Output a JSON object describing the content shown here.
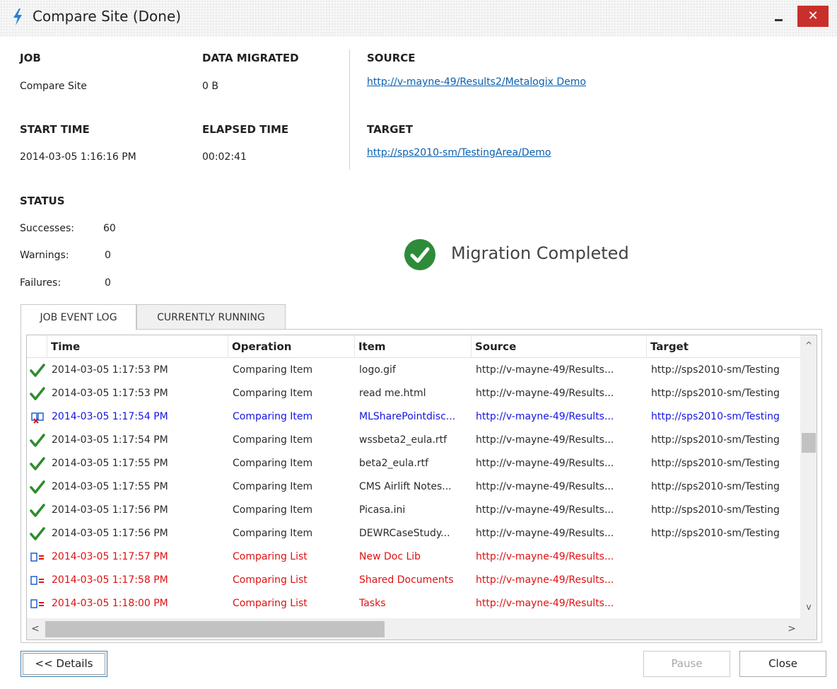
{
  "window": {
    "title": "Compare Site (Done)",
    "close_glyph": "✕"
  },
  "summary": {
    "job_label": "JOB",
    "job_value": "Compare Site",
    "data_migrated_label": "DATA MIGRATED",
    "data_migrated_value": "0 B",
    "start_time_label": "START TIME",
    "start_time_value": "2014-03-05 1:16:16 PM",
    "elapsed_time_label": "ELAPSED TIME",
    "elapsed_time_value": "00:02:41",
    "source_label": "SOURCE",
    "source_url": "http://v-mayne-49/Results2/Metalogix Demo",
    "target_label": "TARGET",
    "target_url": "http://sps2010-sm/TestingArea/Demo"
  },
  "status": {
    "label": "STATUS",
    "successes_label": "Successes:",
    "successes_value": "60",
    "warnings_label": "Warnings:",
    "warnings_value": "0",
    "failures_label": "Failures:",
    "failures_value": "0",
    "message": "Migration Completed"
  },
  "tabs": [
    {
      "label": "JOB EVENT LOG",
      "active": true
    },
    {
      "label": "CURRENTLY RUNNING",
      "active": false
    }
  ],
  "log": {
    "columns": [
      "Time",
      "Operation",
      "Item",
      "Source",
      "Target"
    ],
    "rows": [
      {
        "status": "success",
        "time": "2014-03-05 1:17:53 PM",
        "operation": "Comparing Item",
        "item": "logo.gif",
        "source": "http://v-mayne-49/Results...",
        "target": "http://sps2010-sm/Testing"
      },
      {
        "status": "success",
        "time": "2014-03-05 1:17:53 PM",
        "operation": "Comparing Item",
        "item": "read me.html",
        "source": "http://v-mayne-49/Results...",
        "target": "http://sps2010-sm/Testing"
      },
      {
        "status": "difference",
        "time": "2014-03-05 1:17:54 PM",
        "operation": "Comparing Item",
        "item": "MLSharePointdisc...",
        "source": "http://v-mayne-49/Results...",
        "target": "http://sps2010-sm/Testing"
      },
      {
        "status": "success",
        "time": "2014-03-05 1:17:54 PM",
        "operation": "Comparing Item",
        "item": "wssbeta2_eula.rtf",
        "source": "http://v-mayne-49/Results...",
        "target": "http://sps2010-sm/Testing"
      },
      {
        "status": "success",
        "time": "2014-03-05 1:17:55 PM",
        "operation": "Comparing Item",
        "item": "beta2_eula.rtf",
        "source": "http://v-mayne-49/Results...",
        "target": "http://sps2010-sm/Testing"
      },
      {
        "status": "success",
        "time": "2014-03-05 1:17:55 PM",
        "operation": "Comparing Item",
        "item": "CMS Airlift Notes...",
        "source": "http://v-mayne-49/Results...",
        "target": "http://sps2010-sm/Testing"
      },
      {
        "status": "success",
        "time": "2014-03-05 1:17:56 PM",
        "operation": "Comparing Item",
        "item": "Picasa.ini",
        "source": "http://v-mayne-49/Results...",
        "target": "http://sps2010-sm/Testing"
      },
      {
        "status": "success",
        "time": "2014-03-05 1:17:56 PM",
        "operation": "Comparing Item",
        "item": "DEWRCaseStudy...",
        "source": "http://v-mayne-49/Results...",
        "target": "http://sps2010-sm/Testing"
      },
      {
        "status": "list-diff",
        "time": "2014-03-05 1:17:57 PM",
        "operation": "Comparing List",
        "item": "New Doc Lib",
        "source": "http://v-mayne-49/Results...",
        "target": ""
      },
      {
        "status": "list-diff",
        "time": "2014-03-05 1:17:58 PM",
        "operation": "Comparing List",
        "item": "Shared Documents",
        "source": "http://v-mayne-49/Results...",
        "target": ""
      },
      {
        "status": "list-diff",
        "time": "2014-03-05 1:18:00 PM",
        "operation": "Comparing List",
        "item": "Tasks",
        "source": "http://v-mayne-49/Results...",
        "target": ""
      }
    ]
  },
  "buttons": {
    "details": "<< Details",
    "pause": "Pause",
    "close": "Close"
  },
  "scroll_glyphs": {
    "up": "^",
    "down": "v",
    "left": "<",
    "right": ">"
  },
  "colors": {
    "success": "#2e8b2e",
    "difference": "#1515e0",
    "failure": "#e01010",
    "link": "#0a5fb0",
    "close_button": "#c9302c"
  }
}
